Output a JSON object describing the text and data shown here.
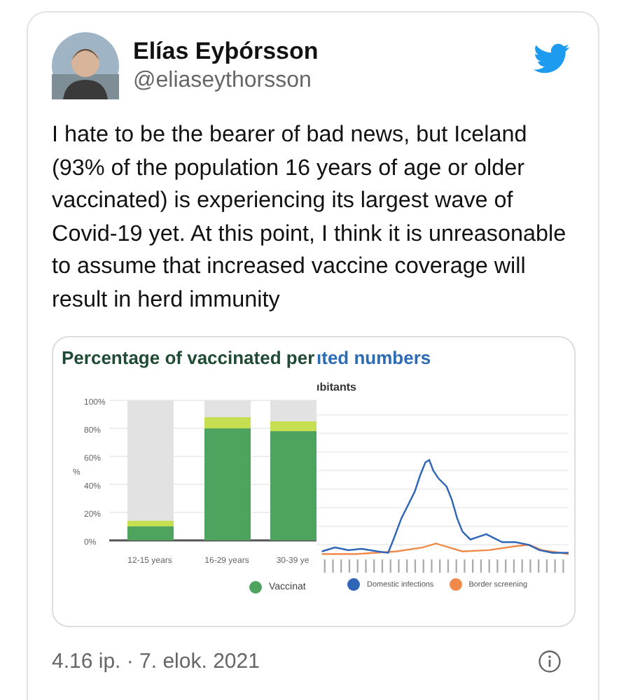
{
  "tweet": {
    "name": "Elías Eyþórsson",
    "handle": "@eliaseythorsson",
    "text": "I hate to be the bearer of bad news, but Iceland (93% of the population 16 years of age or older vaccinated) is experiencing its largest wave of Covid-19 yet. At this point, I think it is unreasonable to assume that increased vaccine coverage will result in herd immunity",
    "timestamp": "4.16 ip. · 7. elok. 2021"
  },
  "image": {
    "left_panel": {
      "title": "Percentage of vaccinated per",
      "chart_data": {
        "type": "bar",
        "stacked": true,
        "grid": true,
        "ylabel": "%",
        "categories": [
          "12-15 years",
          "16-29 years",
          "30-39 ye"
        ],
        "yticks": [
          {
            "value": 0,
            "label": "0%"
          },
          {
            "value": 20,
            "label": "20%"
          },
          {
            "value": 40,
            "label": "40%"
          },
          {
            "value": 60,
            "label": "60%"
          },
          {
            "value": 80,
            "label": "80%"
          },
          {
            "value": 100,
            "label": "100%"
          }
        ],
        "ylim": [
          0,
          100
        ],
        "series": [
          {
            "name": "Vaccinat",
            "color": "#4ea35f",
            "values": [
              10,
              80,
              78
            ]
          },
          {
            "color": "#c6df52",
            "values": [
              4,
              8,
              7
            ]
          },
          {
            "color": "#e2e2e2",
            "values": [
              86,
              12,
              15
            ]
          }
        ]
      }
    },
    "right_panel": {
      "title": "ıted numbers",
      "subtitle": "ıbitants",
      "legend": [
        {
          "label": "Domestic infections",
          "color": "#2f66b8"
        },
        {
          "label": "Border screening",
          "color": "#f08a4b"
        }
      ]
    }
  }
}
